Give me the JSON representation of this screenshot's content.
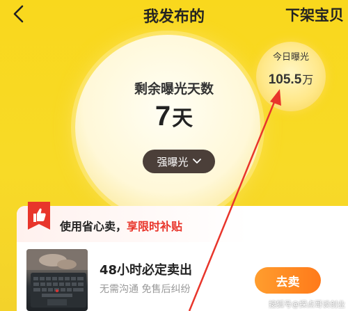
{
  "header": {
    "title": "我发布的",
    "right_action": "下架宝贝",
    "back_icon": "chevron-left-icon"
  },
  "exposure": {
    "remaining_label": "剩余曝光天数",
    "remaining_value": "7",
    "remaining_unit": "天",
    "boost_label": "强曝光",
    "boost_icon": "chevron-down-icon"
  },
  "today": {
    "label": "今日曝光",
    "value": "105.5",
    "unit": "万"
  },
  "promo": {
    "prefix": "使用省心卖，",
    "highlight": "享限时补贴",
    "icon": "thumbs-up-badge-icon",
    "highlight_color": "#e8352b"
  },
  "item": {
    "title": "48小时必定卖出",
    "subtitle": "无需沟通 免售后纠纷",
    "action_label": "去卖"
  },
  "watermark": "搜狐号@探点哥谈创业",
  "colors": {
    "background": "#f8da27",
    "accent_red": "#e8352b",
    "button_orange": "#ff8a24",
    "boost_dark": "#4b3f39"
  }
}
